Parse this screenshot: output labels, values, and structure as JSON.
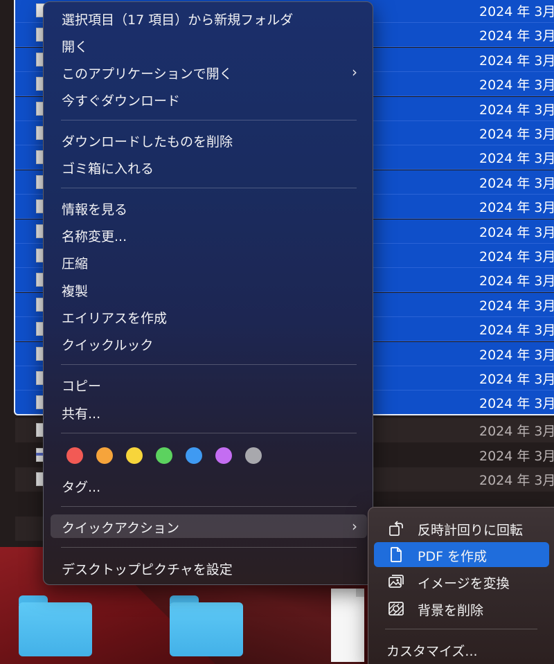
{
  "finder": {
    "selected_rows": [
      {
        "date": "2024 年 3月"
      },
      {
        "date": "2024 年 3月"
      },
      {
        "date": "2024 年 3月"
      },
      {
        "date": "2024 年 3月"
      },
      {
        "date": "2024 年 3月"
      },
      {
        "date": "2024 年 3月"
      },
      {
        "date": "2024 年 3月"
      },
      {
        "date": "2024 年 3月"
      },
      {
        "date": "2024 年 3月"
      },
      {
        "date": "2024 年 3月"
      },
      {
        "date": "2024 年 3月"
      },
      {
        "date": "2024 年 3月"
      },
      {
        "date": "2024 年 3月"
      },
      {
        "date": "2024 年 3月"
      },
      {
        "date": "2024 年 3月"
      },
      {
        "date": "2024 年 3月"
      },
      {
        "date": "2024 年 3月"
      }
    ],
    "other_rows": [
      {
        "date": "2024 年 3月"
      },
      {
        "date": "2024 年 3月"
      },
      {
        "date": "2024 年 3月"
      }
    ]
  },
  "context_menu": {
    "new_folder_from_selection": "選択項目（17 項目）から新規フォルダ",
    "open": "開く",
    "open_with": "このアプリケーションで開く",
    "download_now": "今すぐダウンロード",
    "remove_download": "ダウンロードしたものを削除",
    "move_to_trash": "ゴミ箱に入れる",
    "get_info": "情報を見る",
    "rename": "名称変更...",
    "compress": "圧縮",
    "duplicate": "複製",
    "make_alias": "エイリアスを作成",
    "quick_look": "クイックルック",
    "copy": "コピー",
    "share": "共有...",
    "tag_colors": [
      "#f25a55",
      "#f6a43b",
      "#f7d53b",
      "#5cd25f",
      "#3f9af2",
      "#c46df2",
      "#a8a8ad"
    ],
    "tags": "タグ...",
    "quick_actions": "クイックアクション",
    "set_desktop_picture": "デスクトップピクチャを設定"
  },
  "quick_actions_submenu": {
    "rotate_left": "反時計回りに回転",
    "create_pdf": "PDF を作成",
    "convert_image": "イメージを変換",
    "remove_background": "背景を削除",
    "customize": "カスタマイズ..."
  },
  "colors": {
    "selection": "#0f4fc9",
    "menu_highlight": "#1f6ddc"
  }
}
